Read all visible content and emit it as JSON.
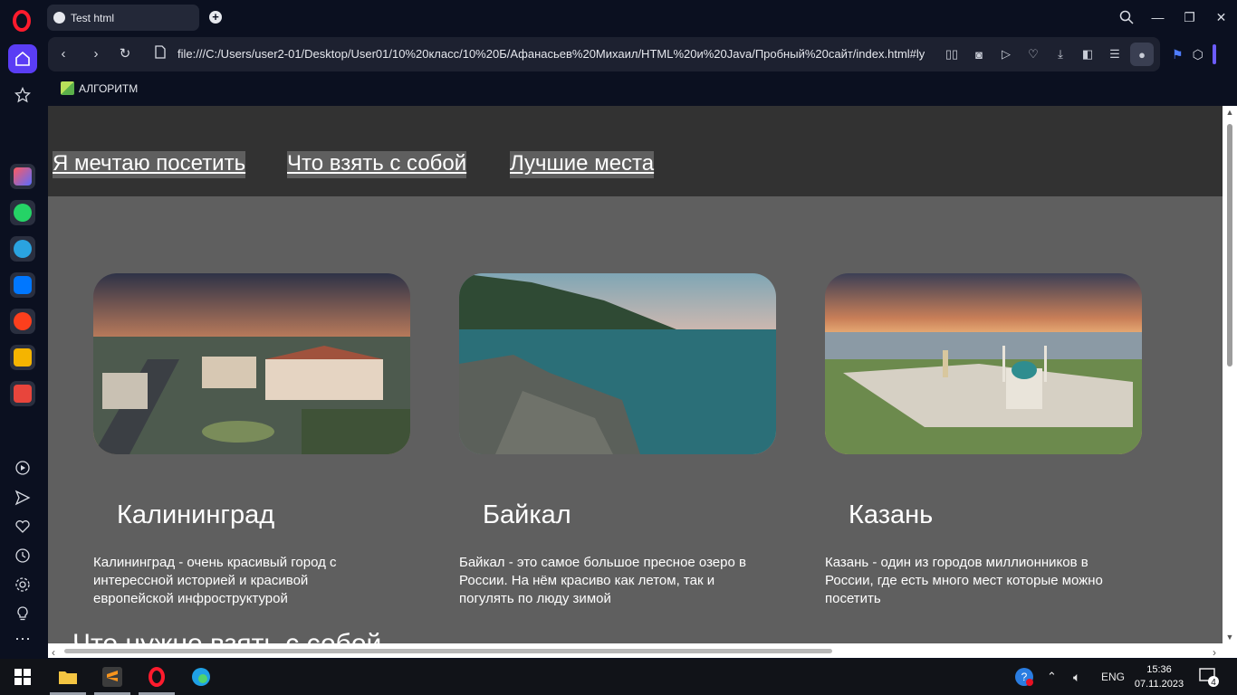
{
  "browser": {
    "tab_title": "Test html",
    "new_tab": "+",
    "url": "file:///C:/Users/user2-01/Desktop/User01/10%20класс/10%20Б/Афанасьев%20Михаил/HTML%20и%20Java/Пробный%20сайт/index.html#lyc",
    "bookmark_label": "АЛГОРИТМ"
  },
  "site": {
    "nav": [
      "Я мечтаю посетить",
      "Что взять с собой",
      "Лучшие места"
    ],
    "cards": [
      {
        "title": "Калининград",
        "text": "Калининград - очень красивый город с интерессной историей и красивой европейской инфроструктурой"
      },
      {
        "title": "Байкал",
        "text": "Байкал - это самое большое пресное озеро в России. На нём красиво как летом, так и погулять по люду зимой"
      },
      {
        "title": "Казань",
        "text": "Казань - один из городов миллионников в России, где есть много мест которые можно посетить"
      }
    ],
    "section_heading": "Что нужно взять с собой"
  },
  "taskbar": {
    "language": "ENG",
    "time": "15:36",
    "date": "07.11.2023",
    "notifications": "4"
  },
  "colors": {
    "accent": "#5a3df5",
    "page_bg": "#5f5f5f",
    "nav_bg": "#323232"
  }
}
